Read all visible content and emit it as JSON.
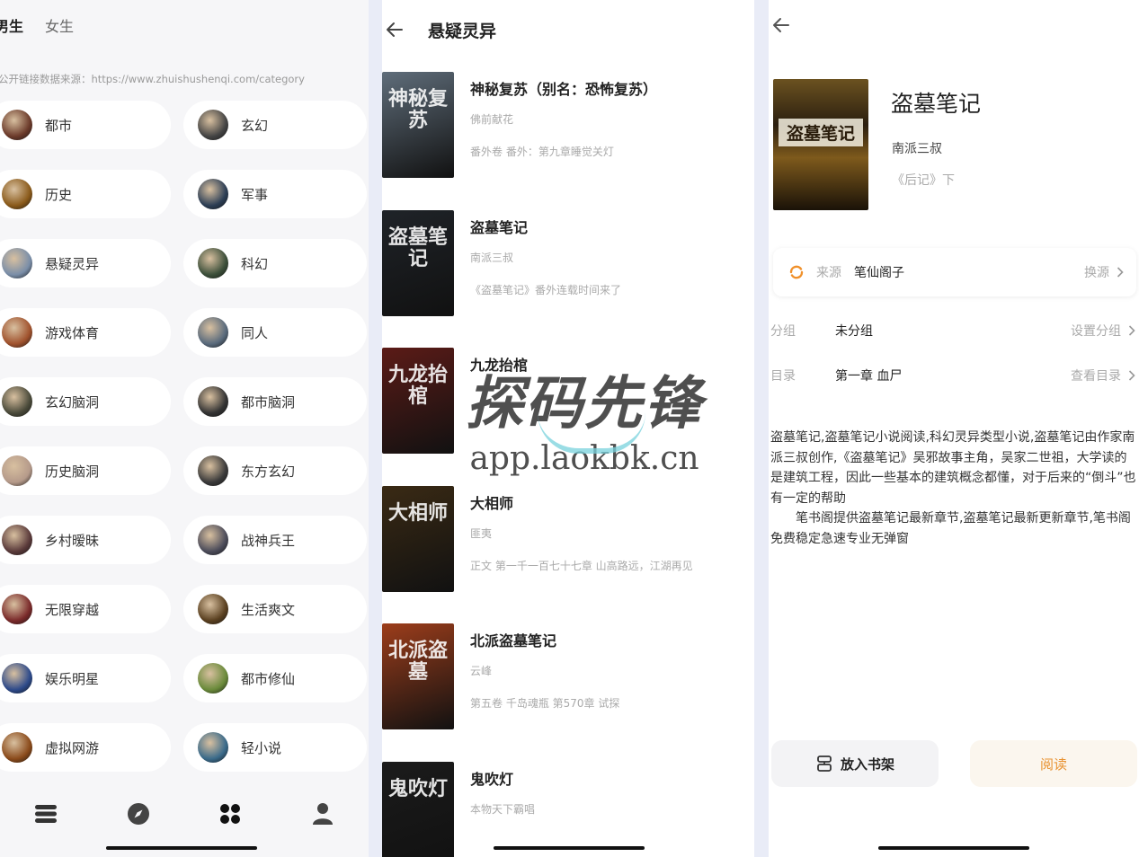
{
  "panel1": {
    "tabs": [
      "男生",
      "女生"
    ],
    "source_text": "公开链接数据来源：https://www.zhuishushenqi.com/category",
    "categories": [
      "都市",
      "玄幻",
      "历史",
      "军事",
      "悬疑灵异",
      "科幻",
      "游戏体育",
      "同人",
      "玄幻脑洞",
      "都市脑洞",
      "历史脑洞",
      "东方玄幻",
      "乡村暧昧",
      "战神兵王",
      "无限穿越",
      "生活爽文",
      "娱乐明星",
      "都市修仙",
      "虚拟网游",
      "轻小说"
    ],
    "nav_icons": [
      "bookshelf-icon",
      "discover-icon",
      "category-icon",
      "profile-icon"
    ]
  },
  "panel2": {
    "title": "悬疑灵异",
    "books": [
      {
        "title": "神秘复苏（别名：恐怖复苏）",
        "author": "佛前献花",
        "latest": "番外卷 番外：第九章睡觉关灯",
        "cover_text": "神秘复苏",
        "cover_color": "#5f6d7a"
      },
      {
        "title": "盗墓笔记",
        "author": "南派三叔",
        "latest": "《盗墓笔记》番外连载时间来了",
        "cover_text": "盗墓笔记",
        "cover_color": "#1f2328"
      },
      {
        "title": "九龙抬棺",
        "author": "",
        "latest": "",
        "cover_text": "九龙抬棺",
        "cover_color": "#5b1b17"
      },
      {
        "title": "大相师",
        "author": "匪夷",
        "latest": "正文 第一千一百七十七章 山高路远，江湖再见",
        "cover_text": "大相师",
        "cover_color": "#3a2a14"
      },
      {
        "title": "北派盗墓笔记",
        "author": "云峰",
        "latest": "第五卷 千岛魂瓶 第570章 试探",
        "cover_text": "北派盗墓",
        "cover_color": "#9c3d1b"
      },
      {
        "title": "鬼吹灯",
        "author": "本物天下霸唱",
        "latest": "",
        "cover_text": "鬼吹灯",
        "cover_color": "#1b1b1b"
      }
    ]
  },
  "panel3": {
    "book_title": "盗墓笔记",
    "author": "南派三叔",
    "latest": "《后记》下",
    "cover_text": "盗墓笔记",
    "source_label": "来源",
    "source_name": "笔仙阁子",
    "source_change": "换源",
    "group_label": "分组",
    "group_value": "未分组",
    "group_action": "设置分组",
    "toc_label": "目录",
    "toc_value": "第一章 血尸",
    "toc_action": "查看目录",
    "desc1": "盗墓笔记,盗墓笔记小说阅读,科幻灵异类型小说,盗墓笔记由作家南派三叔创作,《盗墓笔记》吴邪故事主角，吴家二世祖，大学读的是建筑工程，因此一些基本的建筑概念都懂，对于后来的“倒斗”也有一定的帮助",
    "desc2": "　　笔书阁提供盗墓笔记最新章节,盗墓笔记最新更新章节,笔书阁免费稳定急速专业无弹窗",
    "add_shelf": "放入书架",
    "read": "阅读"
  },
  "watermark": {
    "line1": "探码先锋",
    "line2": "app.laokbk.cn"
  }
}
